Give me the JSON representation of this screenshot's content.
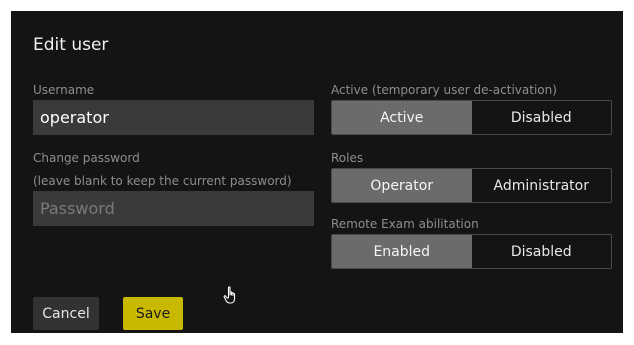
{
  "dialog": {
    "title": "Edit user",
    "username": {
      "label": "Username",
      "value": "operator"
    },
    "password": {
      "label": "Change password",
      "hint": "(leave blank to keep the current password)",
      "placeholder": "Password"
    },
    "active": {
      "label": "Active (temporary user de-activation)",
      "options": [
        "Active",
        "Disabled"
      ],
      "selected": "Active"
    },
    "roles": {
      "label": "Roles",
      "options": [
        "Operator",
        "Administrator"
      ],
      "selected": "Operator"
    },
    "remote_exam": {
      "label": "Remote Exam abilitation",
      "options": [
        "Enabled",
        "Disabled"
      ],
      "selected": "Enabled"
    },
    "buttons": {
      "cancel": "Cancel",
      "save": "Save"
    }
  },
  "colors": {
    "background": "#141414",
    "field": "#3a3a3a",
    "segment_selected": "#6b6b6b",
    "accent": "#c8b900"
  },
  "icons": {
    "cursor": "hand-pointer-icon"
  }
}
